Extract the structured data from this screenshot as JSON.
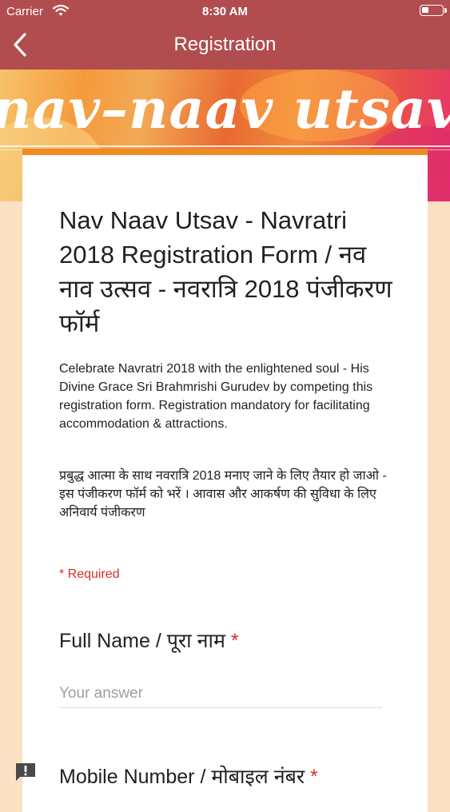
{
  "status_bar": {
    "carrier": "Carrier",
    "time": "8:30 AM"
  },
  "nav": {
    "title": "Registration"
  },
  "banner": {
    "logo_text": "nav–naav utsav"
  },
  "form": {
    "title": "Nav Naav Utsav - Navratri 2018 Registration Form / नव नाव उत्सव - नवरात्रि 2018 पंजीकरण फॉर्म",
    "description_en": "Celebrate Navratri 2018 with the enlightened soul - His Divine Grace Sri Brahmrishi Gurudev by competing this registration form. Registration mandatory for facilitating accommodation & attractions.",
    "description_hi_1": "प्रबुद्ध आत्मा के साथ नवरात्रि 2018 मनाए जाने के लिए तैयार हो जाओ -",
    "description_hi_2": "इस पंजीकरण फॉर्म को भरें । आवास और आकर्षण की सुविधा के लिए अनिवार्य पंजीकरण",
    "required_note": "* Required",
    "questions": [
      {
        "label": "Full Name / पूरा नाम",
        "required_mark": "*",
        "placeholder": "Your answer",
        "value": ""
      },
      {
        "label": "Mobile Number / मोबाइल नंबर",
        "required_mark": "*"
      }
    ]
  },
  "colors": {
    "nav_bg": "#b14d4f",
    "card_accent": "#f08a24",
    "required": "#d93025"
  }
}
